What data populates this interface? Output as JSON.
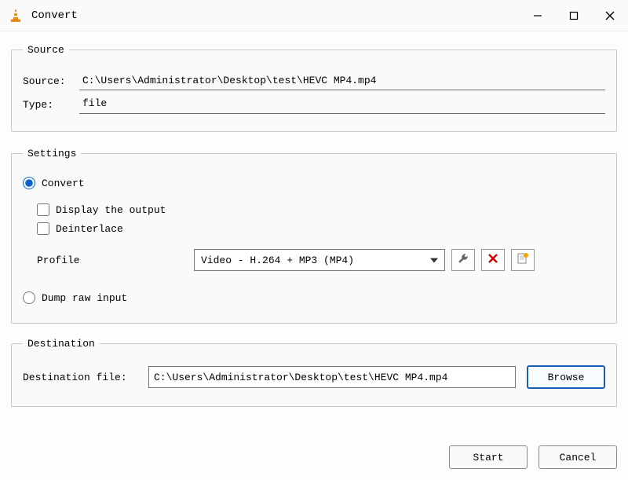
{
  "window": {
    "title": "Convert"
  },
  "source": {
    "legend": "Source",
    "source_label": "Source:",
    "source_value": "C:\\Users\\Administrator\\Desktop\\test\\HEVC MP4.mp4",
    "type_label": "Type:",
    "type_value": "file"
  },
  "settings": {
    "legend": "Settings",
    "convert_label": "Convert",
    "display_output_label": "Display the output",
    "deinterlace_label": "Deinterlace",
    "profile_label": "Profile",
    "profile_value": "Video - H.264 + MP3 (MP4)",
    "dump_label": "Dump raw input"
  },
  "destination": {
    "legend": "Destination",
    "dest_label": "Destination file:",
    "dest_value": "C:\\Users\\Administrator\\Desktop\\test\\HEVC MP4.mp4",
    "browse_label": "Browse"
  },
  "footer": {
    "start_label": "Start",
    "cancel_label": "Cancel"
  }
}
